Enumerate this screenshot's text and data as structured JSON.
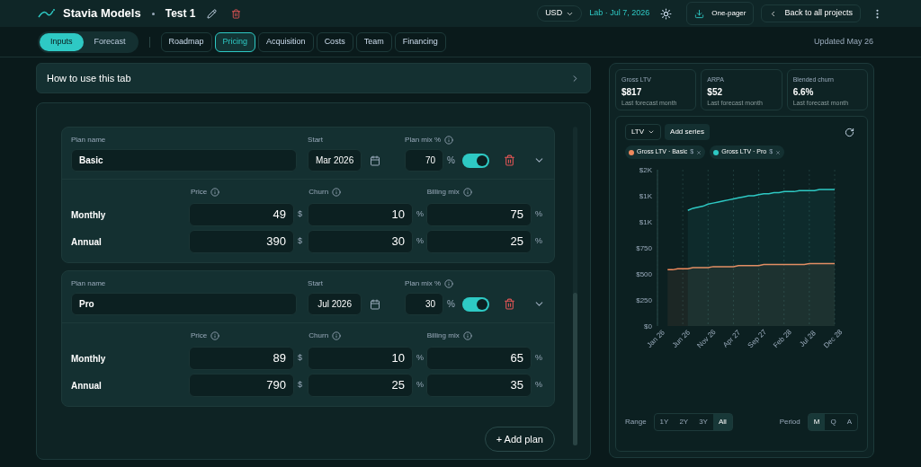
{
  "header": {
    "brand": "Stavia Models",
    "project": "Test 1",
    "currency": "USD",
    "lab": "Lab · Jul 7, 2026",
    "one_pager": "One-pager",
    "back": "Back to all projects"
  },
  "view_toggle": [
    {
      "label": "Inputs",
      "selected": true
    },
    {
      "label": "Forecast",
      "selected": false
    }
  ],
  "tabs": [
    {
      "label": "Roadmap",
      "selected": false
    },
    {
      "label": "Pricing",
      "selected": true
    },
    {
      "label": "Acquisition",
      "selected": false
    },
    {
      "label": "Costs",
      "selected": false
    },
    {
      "label": "Team",
      "selected": false
    },
    {
      "label": "Financing",
      "selected": false
    }
  ],
  "updated": "Updated May 26",
  "how_to": "How to use this tab",
  "plans": [
    {
      "name_label": "Plan name",
      "name": "Basic",
      "start_label": "Start",
      "start": "Mar 2026",
      "mix_label": "Plan mix %",
      "mix": "70",
      "mix_unit": "%",
      "enabled": true,
      "columns": [
        "Price",
        "Churn",
        "Billing mix"
      ],
      "rows": [
        {
          "label": "Monthly",
          "cells": [
            {
              "value": "49",
              "unit": "$"
            },
            {
              "value": "10",
              "unit": "%"
            },
            {
              "value": "75",
              "unit": "%"
            }
          ]
        },
        {
          "label": "Annual",
          "cells": [
            {
              "value": "390",
              "unit": "$"
            },
            {
              "value": "30",
              "unit": "%"
            },
            {
              "value": "25",
              "unit": "%"
            }
          ]
        }
      ]
    },
    {
      "name_label": "Plan name",
      "name": "Pro",
      "start_label": "Start",
      "start": "Jul 2026",
      "mix_label": "Plan mix %",
      "mix": "30",
      "mix_unit": "%",
      "enabled": true,
      "columns": [
        "Price",
        "Churn",
        "Billing mix"
      ],
      "rows": [
        {
          "label": "Monthly",
          "cells": [
            {
              "value": "89",
              "unit": "$"
            },
            {
              "value": "10",
              "unit": "%"
            },
            {
              "value": "65",
              "unit": "%"
            }
          ]
        },
        {
          "label": "Annual",
          "cells": [
            {
              "value": "790",
              "unit": "$"
            },
            {
              "value": "25",
              "unit": "%"
            },
            {
              "value": "35",
              "unit": "%"
            }
          ]
        }
      ]
    }
  ],
  "add_plan": "+ Add plan",
  "kpis": [
    {
      "label": "Gross LTV",
      "value": "$817",
      "note": "Last forecast month"
    },
    {
      "label": "ARPA",
      "value": "$52",
      "note": "Last forecast month"
    },
    {
      "label": "Blended churn",
      "value": "6.6%",
      "note": "Last forecast month"
    }
  ],
  "metric": "LTV",
  "add_series": "Add series",
  "legend": [
    {
      "unit": "$"
    },
    {
      "unit": "$"
    }
  ],
  "chart_data": {
    "type": "area",
    "categories": [
      "Jan 26",
      null,
      null,
      null,
      null,
      "Jun 26",
      null,
      null,
      null,
      null,
      "Nov 26",
      null,
      null,
      null,
      null,
      "Apr 27",
      null,
      null,
      null,
      null,
      "Sep 27",
      null,
      null,
      null,
      null,
      "Feb 28",
      null,
      null,
      null,
      null,
      "Jul 28",
      null,
      null,
      null,
      null,
      "Dec 28"
    ],
    "yticks": [
      {
        "value": 0,
        "label": "$0"
      },
      {
        "value": 250,
        "label": "$250"
      },
      {
        "value": 500,
        "label": "$500"
      },
      {
        "value": 750,
        "label": "$750"
      },
      {
        "value": 1000,
        "label": "$1K"
      },
      {
        "value": 1250,
        "label": "$1K"
      },
      {
        "value": 1500,
        "label": "$2K"
      }
    ],
    "ylim": [
      0,
      1500
    ],
    "series": [
      {
        "name": "Gross LTV · Basic",
        "color": "#f08a5d",
        "values": [
          null,
          null,
          540,
          540,
          550,
          550,
          550,
          560,
          560,
          560,
          560,
          570,
          570,
          570,
          570,
          570,
          580,
          580,
          580,
          580,
          580,
          590,
          590,
          590,
          590,
          590,
          590,
          590,
          590,
          590,
          600,
          600,
          600,
          600,
          600,
          600
        ]
      },
      {
        "name": "Gross LTV · Pro",
        "color": "#2ec9c4",
        "values": [
          null,
          null,
          null,
          null,
          null,
          null,
          1110,
          1130,
          1140,
          1150,
          1170,
          1180,
          1190,
          1200,
          1210,
          1220,
          1230,
          1240,
          1250,
          1250,
          1260,
          1270,
          1270,
          1280,
          1280,
          1290,
          1290,
          1290,
          1300,
          1300,
          1300,
          1300,
          1310,
          1310,
          1310,
          1310
        ]
      }
    ]
  },
  "range": {
    "label": "Range",
    "options": [
      {
        "label": "1Y",
        "selected": false
      },
      {
        "label": "2Y",
        "selected": false
      },
      {
        "label": "3Y",
        "selected": false
      },
      {
        "label": "All",
        "selected": true
      }
    ]
  },
  "period": {
    "label": "Period",
    "options": [
      {
        "label": "M",
        "selected": true
      },
      {
        "label": "Q",
        "selected": false
      },
      {
        "label": "A",
        "selected": false
      }
    ]
  }
}
